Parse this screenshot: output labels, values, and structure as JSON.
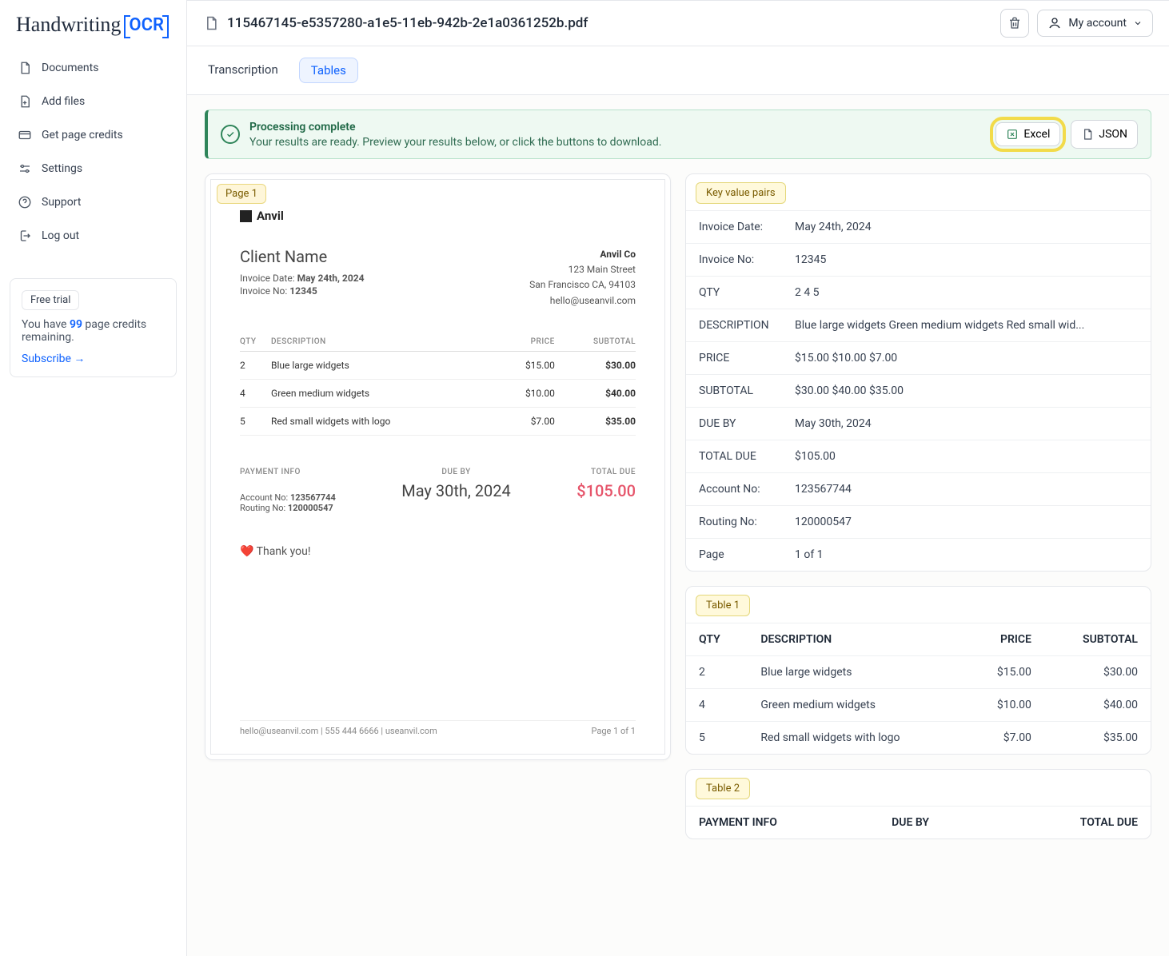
{
  "logo": {
    "script": "Handwriting",
    "ocr": "OCR"
  },
  "sidebar": {
    "items": [
      {
        "label": "Documents",
        "icon": "document-icon"
      },
      {
        "label": "Add files",
        "icon": "add-file-icon"
      },
      {
        "label": "Get page credits",
        "icon": "credits-icon"
      },
      {
        "label": "Settings",
        "icon": "settings-icon"
      },
      {
        "label": "Support",
        "icon": "support-icon"
      },
      {
        "label": "Log out",
        "icon": "logout-icon"
      }
    ],
    "credit": {
      "badge": "Free trial",
      "pre": "You have ",
      "num": "99",
      "post": " page credits remaining.",
      "subscribe": "Subscribe →"
    }
  },
  "topbar": {
    "filename": "115467145-e5357280-a1e5-11eb-942b-2e1a0361252b.pdf",
    "account": "My account"
  },
  "tabs": {
    "transcription": "Transcription",
    "tables": "Tables"
  },
  "alert": {
    "title": "Processing complete",
    "msg": "Your results are ready. Preview your results below, or click the buttons to download.",
    "excel": "Excel",
    "json": "JSON"
  },
  "preview": {
    "chip": "Page 1",
    "brand": "Anvil",
    "client": "Client Name",
    "invoice_date_lbl": "Invoice Date: ",
    "invoice_date_val": "May 24th, 2024",
    "invoice_no_lbl": "Invoice No: ",
    "invoice_no_val": "12345",
    "company": "Anvil Co",
    "addr1": "123 Main Street",
    "addr2": "San Francisco CA, 94103",
    "email": "hello@useanvil.com",
    "cols": {
      "qty": "QTY",
      "desc": "DESCRIPTION",
      "price": "PRICE",
      "sub": "SUBTOTAL"
    },
    "rows": [
      {
        "qty": "2",
        "desc": "Blue large widgets",
        "price": "$15.00",
        "sub": "$30.00"
      },
      {
        "qty": "4",
        "desc": "Green medium widgets",
        "price": "$10.00",
        "sub": "$40.00"
      },
      {
        "qty": "5",
        "desc": "Red small widgets with logo",
        "price": "$7.00",
        "sub": "$35.00"
      }
    ],
    "pay": {
      "info_h": "PAYMENT INFO",
      "acc_lbl": "Account No: ",
      "acc_val": "123567744",
      "rout_lbl": "Routing No: ",
      "rout_val": "120000547",
      "due_h": "DUE BY",
      "due_val": "May 30th, 2024",
      "tot_h": "TOTAL DUE",
      "tot_val": "$105.00"
    },
    "thanks": "❤️  Thank you!",
    "footer_left": "hello@useanvil.com   |   555 444 6666   |   useanvil.com",
    "footer_right": "Page 1 of 1"
  },
  "kv": {
    "title": "Key value pairs",
    "rows": [
      {
        "k": "Invoice Date:",
        "v": "May 24th, 2024"
      },
      {
        "k": "Invoice No:",
        "v": "12345"
      },
      {
        "k": "QTY",
        "v": "2 4 5"
      },
      {
        "k": "DESCRIPTION",
        "v": "Blue large widgets Green medium widgets Red small wid..."
      },
      {
        "k": "PRICE",
        "v": "$15.00 $10.00 $7.00"
      },
      {
        "k": "SUBTOTAL",
        "v": "$30.00 $40.00 $35.00"
      },
      {
        "k": "DUE BY",
        "v": "May 30th, 2024"
      },
      {
        "k": "TOTAL DUE",
        "v": "$105.00"
      },
      {
        "k": "Account No:",
        "v": "123567744"
      },
      {
        "k": "Routing No:",
        "v": "120000547"
      },
      {
        "k": "Page",
        "v": "1 of 1"
      }
    ]
  },
  "table1": {
    "title": "Table 1",
    "head": {
      "qty": "QTY",
      "desc": "DESCRIPTION",
      "price": "PRICE",
      "sub": "SUBTOTAL"
    },
    "rows": [
      {
        "qty": "2",
        "desc": "Blue large widgets",
        "price": "$15.00",
        "sub": "$30.00"
      },
      {
        "qty": "4",
        "desc": "Green medium widgets",
        "price": "$10.00",
        "sub": "$40.00"
      },
      {
        "qty": "5",
        "desc": "Red small widgets with logo",
        "price": "$7.00",
        "sub": "$35.00"
      }
    ]
  },
  "table2": {
    "title": "Table 2",
    "head": {
      "pi": "PAYMENT INFO",
      "due": "DUE BY",
      "tot": "TOTAL DUE"
    }
  }
}
